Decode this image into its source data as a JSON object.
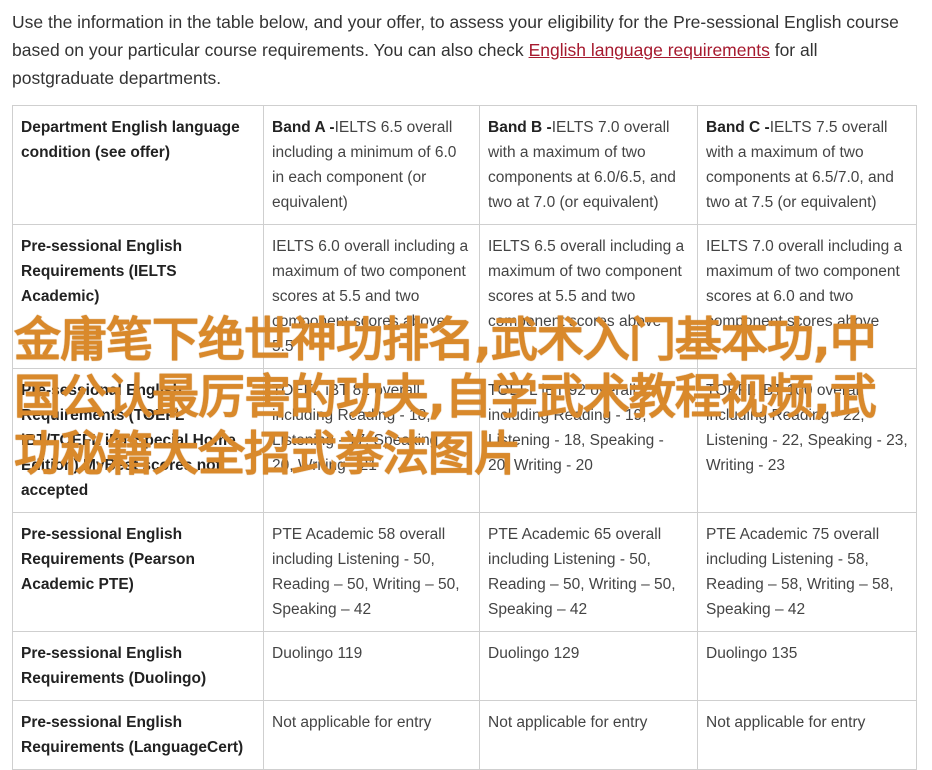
{
  "intro": {
    "text_before_link": "Use the information in the table below, and your offer, to assess your eligibility for the Pre-sessional English course based on your particular course requirements. You can also check ",
    "link_text": "English language requirements",
    "text_after_link": " for all postgraduate departments."
  },
  "table": {
    "header": {
      "col0": "Department English language condition (see offer)",
      "bands": [
        {
          "name": "Band A -",
          "desc": "IELTS 6.5 overall including a minimum of 6.0 in each component (or equivalent)"
        },
        {
          "name": "Band B -",
          "desc": "IELTS 7.0 overall with a maximum of two components at 6.0/6.5, and two at 7.0 (or equivalent)"
        },
        {
          "name": "Band C -",
          "desc": "IELTS 7.5 overall with a maximum of two components at 6.5/7.0, and two at 7.5 (or equivalent)"
        }
      ]
    },
    "rows": [
      {
        "label": "Pre-sessional English Requirements (IELTS Academic)",
        "cells": [
          "IELTS 6.0 overall including a maximum of two component scores at 5.5 and two component scores above 5.5",
          "IELTS 6.5 overall including a maximum of two component scores at 5.5 and two component scores above",
          "IELTS 7.0 overall including a maximum of two component scores at 6.0 and two component scores above"
        ]
      },
      {
        "label": "Pre-sessional English Requirements (TOEFL iBT/TOEFL iBT Special Home Edition) MyBest scores not accepted",
        "cells": [
          "TOEFL iBT 82 overall including Reading - 18, Listening - 17, Speaking - 20, Writing - 21",
          "TOEFL iBT 92 overall including Reading - 19, Listening - 18, Speaking - 20, Writing - 20",
          "TOEFL iBT 100 overall including Reading - 22, Listening - 22, Speaking - 23, Writing - 23"
        ]
      },
      {
        "label": "Pre-sessional English Requirements (Pearson Academic PTE)",
        "cells": [
          "PTE Academic 58 overall including Listening - 50, Reading – 50, Writing – 50, Speaking – 42",
          "PTE Academic 65 overall including Listening - 50, Reading – 50, Writing – 50, Speaking – 42",
          "PTE Academic 75 overall including Listening - 58, Reading – 58, Writing – 58, Speaking – 42"
        ]
      },
      {
        "label": "Pre-sessional English Requirements (Duolingo)",
        "cells": [
          "Duolingo 119",
          "Duolingo 129",
          "Duolingo 135"
        ]
      },
      {
        "label": "Pre-sessional English Requirements (LanguageCert)",
        "cells": [
          "Not applicable for entry",
          "Not applicable for entry",
          "Not applicable for entry"
        ]
      }
    ]
  },
  "overlay": {
    "text": "金庸笔下绝世神功排名,武术入门基本功,中国公认最厉害的功夫,自学武术教程视频,武功秘籍大全招式拳法图片"
  },
  "colors": {
    "link": "#a6192e",
    "watermark": "#d9892b",
    "border": "#cfcfcf"
  }
}
